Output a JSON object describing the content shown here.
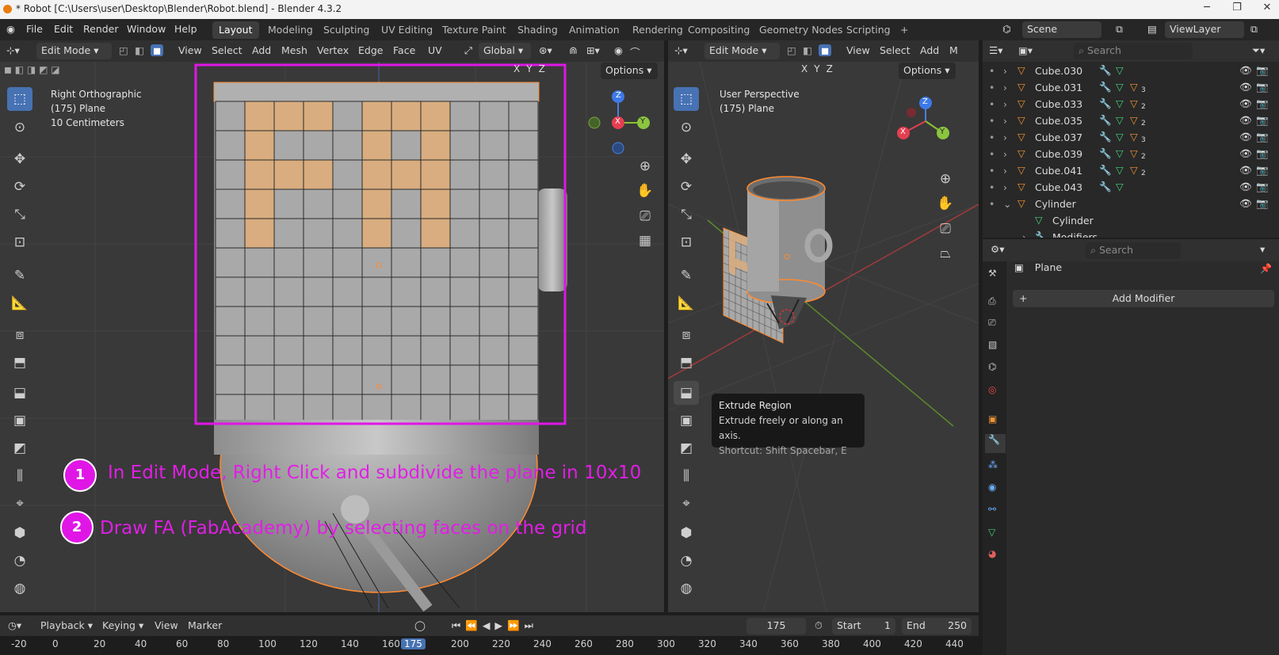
{
  "window": {
    "title": "* Robot [C:\\Users\\user\\Desktop\\Blender\\Robot.blend] - Blender 4.3.2"
  },
  "menu": {
    "items": [
      "File",
      "Edit",
      "Render",
      "Window",
      "Help"
    ]
  },
  "workspaces": [
    "Layout",
    "Modeling",
    "Sculpting",
    "UV Editing",
    "Texture Paint",
    "Shading",
    "Animation",
    "Rendering",
    "Compositing",
    "Geometry Nodes",
    "Scripting"
  ],
  "workspace_add": "+",
  "scene": {
    "name": "Scene",
    "view_layer": "ViewLayer"
  },
  "left_viewport": {
    "mode": "Edit Mode",
    "menus": [
      "View",
      "Select",
      "Add",
      "Mesh",
      "Vertex",
      "Edge",
      "Face",
      "UV"
    ],
    "transform": "Global",
    "axes": [
      "X",
      "Y",
      "Z"
    ],
    "options": "Options",
    "info": [
      "Right Orthographic",
      "(175) Plane",
      "10 Centimeters"
    ],
    "gizmo": {
      "z": "Z",
      "x": "X",
      "y": "Y"
    }
  },
  "right_viewport": {
    "mode": "Edit Mode",
    "menus": [
      "View",
      "Select",
      "Add",
      "M"
    ],
    "axes": [
      "X",
      "Y",
      "Z"
    ],
    "options": "Options",
    "info": [
      "User Perspective",
      "(175) Plane"
    ],
    "gizmo": {
      "z": "Z",
      "x": "X",
      "y": "Y"
    }
  },
  "tooltip": {
    "title": "Extrude Region",
    "desc": "Extrude freely or along an axis.",
    "shortcut": "Shortcut: Shift Spacebar, E"
  },
  "instructions": [
    {
      "num": "1",
      "text": "In Edit Mode, Right Click and subdivide the plane in 10x10"
    },
    {
      "num": "2",
      "text": "Draw FA (FabAcademy) by selecting faces on the grid"
    }
  ],
  "fa_selected_cells": [
    [
      1,
      0
    ],
    [
      2,
      0
    ],
    [
      3,
      0
    ],
    [
      5,
      0
    ],
    [
      6,
      0
    ],
    [
      7,
      0
    ],
    [
      1,
      1
    ],
    [
      5,
      1
    ],
    [
      7,
      1
    ],
    [
      1,
      2
    ],
    [
      2,
      2
    ],
    [
      3,
      2
    ],
    [
      5,
      2
    ],
    [
      6,
      2
    ],
    [
      7,
      2
    ],
    [
      1,
      3
    ],
    [
      5,
      3
    ],
    [
      7,
      3
    ],
    [
      1,
      4
    ],
    [
      5,
      4
    ],
    [
      7,
      4
    ]
  ],
  "outliner": {
    "search_placeholder": "Search",
    "items": [
      {
        "name": "Cube.030",
        "count": ""
      },
      {
        "name": "Cube.031",
        "count": "3"
      },
      {
        "name": "Cube.033",
        "count": "2"
      },
      {
        "name": "Cube.035",
        "count": "2"
      },
      {
        "name": "Cube.037",
        "count": "3"
      },
      {
        "name": "Cube.039",
        "count": "2"
      },
      {
        "name": "Cube.041",
        "count": "2"
      },
      {
        "name": "Cube.043",
        "count": ""
      },
      {
        "name": "Cylinder",
        "count": ""
      }
    ],
    "child": "Cylinder",
    "modifiers": "Modifiers"
  },
  "properties": {
    "search_placeholder": "Search",
    "object": "Plane",
    "add_modifier": "Add Modifier",
    "add_icon": "+"
  },
  "timeline": {
    "menus": [
      "Playback",
      "Keying",
      "View",
      "Marker"
    ],
    "current_frame": "175",
    "start_label": "Start",
    "start": "1",
    "end_label": "End",
    "end": "250",
    "ruler": [
      "-20",
      "0",
      "20",
      "40",
      "60",
      "80",
      "100",
      "120",
      "140",
      "160",
      "175",
      "200",
      "220",
      "240",
      "260",
      "280",
      "300",
      "320",
      "340",
      "360",
      "380",
      "400",
      "420",
      "440"
    ]
  },
  "colors": {
    "accent": "#4772b3",
    "magenta": "#e016e6",
    "selected_face": "#d9ad7f",
    "edit_outline": "#ff8a30"
  }
}
